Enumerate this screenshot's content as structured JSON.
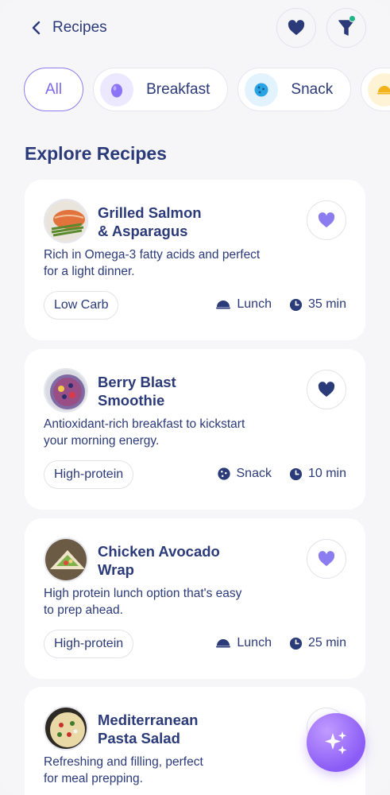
{
  "header": {
    "title": "Recipes"
  },
  "filters": [
    {
      "label": "All",
      "active": true
    },
    {
      "label": "Breakfast",
      "active": false
    },
    {
      "label": "Snack",
      "active": false
    }
  ],
  "section_title": "Explore Recipes",
  "recipes": [
    {
      "title_line1": "Grilled Salmon",
      "title_line2": "& Asparagus",
      "desc_line1": "Rich in Omega-3 fatty acids and perfect",
      "desc_line2": "for a light dinner.",
      "tag": "Low Carb",
      "meal": "Lunch",
      "time": "35 min",
      "favorited": false
    },
    {
      "title_line1": "Berry Blast",
      "title_line2": "Smoothie",
      "desc_line1": "Antioxidant-rich breakfast to kickstart",
      "desc_line2": "your morning energy.",
      "tag": "High-protein",
      "meal": "Snack",
      "time": "10 min",
      "favorited": true
    },
    {
      "title_line1": "Chicken Avocado",
      "title_line2": "Wrap",
      "desc_line1": "High protein lunch option that's easy",
      "desc_line2": "to prep ahead.",
      "tag": "High-protein",
      "meal": "Lunch",
      "time": "25 min",
      "favorited": false
    },
    {
      "title_line1": "Mediterranean",
      "title_line2": "Pasta Salad",
      "desc_line1": "Refreshing and filling, perfect",
      "desc_line2": "for meal prepping."
    }
  ],
  "colors": {
    "primary": "#2b3a78",
    "accent": "#8b7cf0",
    "notify": "#20b486"
  },
  "icons": [
    "chevron-left-icon",
    "heart-icon",
    "filter-icon",
    "egg-icon",
    "cookie-icon",
    "cloche-icon",
    "clock-icon",
    "sparkles-icon"
  ]
}
